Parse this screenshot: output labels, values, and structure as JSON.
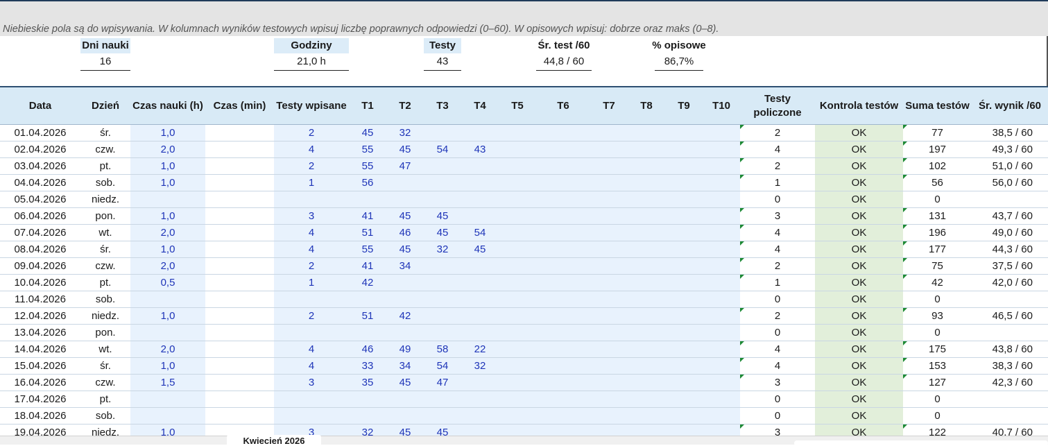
{
  "note": "Niebieskie pola są do wpisywania. W kolumnach wyników testowych wpisuj liczbę poprawnych odpowiedzi (0–60). W opisowych wpisuj: dobrze oraz maks (0–8).",
  "summary": [
    {
      "label": "Dni nauki",
      "value": "16"
    },
    {
      "label": "Godziny",
      "value": "21,0 h"
    },
    {
      "label": "Testy",
      "value": "43"
    },
    {
      "label": "Śr. test /60",
      "value": "44,8  / 60"
    },
    {
      "label": "% opisowe",
      "value": "86,7%"
    }
  ],
  "columns": [
    "Data",
    "Dzień",
    "Czas nauki (h)",
    "Czas (min)",
    "Testy wpisane",
    "T1",
    "T2",
    "T3",
    "T4",
    "T5",
    "T6",
    "T7",
    "T8",
    "T9",
    "T10",
    "Testy policzone",
    "Kontrola testów",
    "Suma testów",
    "Śr. wynik /60"
  ],
  "rows": [
    [
      "01.04.2026",
      "śr.",
      "1,0",
      "",
      "2",
      "45",
      "32",
      "",
      "",
      "",
      "",
      "",
      "",
      "",
      "",
      "2",
      "OK",
      "77",
      "38,5  / 60"
    ],
    [
      "02.04.2026",
      "czw.",
      "2,0",
      "",
      "4",
      "55",
      "45",
      "54",
      "43",
      "",
      "",
      "",
      "",
      "",
      "",
      "4",
      "OK",
      "197",
      "49,3  / 60"
    ],
    [
      "03.04.2026",
      "pt.",
      "1,0",
      "",
      "2",
      "55",
      "47",
      "",
      "",
      "",
      "",
      "",
      "",
      "",
      "",
      "2",
      "OK",
      "102",
      "51,0  / 60"
    ],
    [
      "04.04.2026",
      "sob.",
      "1,0",
      "",
      "1",
      "56",
      "",
      "",
      "",
      "",
      "",
      "",
      "",
      "",
      "",
      "1",
      "OK",
      "56",
      "56,0  / 60"
    ],
    [
      "05.04.2026",
      "niedz.",
      "",
      "",
      "",
      "",
      "",
      "",
      "",
      "",
      "",
      "",
      "",
      "",
      "",
      "0",
      "OK",
      "0",
      ""
    ],
    [
      "06.04.2026",
      "pon.",
      "1,0",
      "",
      "3",
      "41",
      "45",
      "45",
      "",
      "",
      "",
      "",
      "",
      "",
      "",
      "3",
      "OK",
      "131",
      "43,7  / 60"
    ],
    [
      "07.04.2026",
      "wt.",
      "2,0",
      "",
      "4",
      "51",
      "46",
      "45",
      "54",
      "",
      "",
      "",
      "",
      "",
      "",
      "4",
      "OK",
      "196",
      "49,0  / 60"
    ],
    [
      "08.04.2026",
      "śr.",
      "1,0",
      "",
      "4",
      "55",
      "45",
      "32",
      "45",
      "",
      "",
      "",
      "",
      "",
      "",
      "4",
      "OK",
      "177",
      "44,3  / 60"
    ],
    [
      "09.04.2026",
      "czw.",
      "2,0",
      "",
      "2",
      "41",
      "34",
      "",
      "",
      "",
      "",
      "",
      "",
      "",
      "",
      "2",
      "OK",
      "75",
      "37,5  / 60"
    ],
    [
      "10.04.2026",
      "pt.",
      "0,5",
      "",
      "1",
      "42",
      "",
      "",
      "",
      "",
      "",
      "",
      "",
      "",
      "",
      "1",
      "OK",
      "42",
      "42,0  / 60"
    ],
    [
      "11.04.2026",
      "sob.",
      "",
      "",
      "",
      "",
      "",
      "",
      "",
      "",
      "",
      "",
      "",
      "",
      "",
      "0",
      "OK",
      "0",
      ""
    ],
    [
      "12.04.2026",
      "niedz.",
      "1,0",
      "",
      "2",
      "51",
      "42",
      "",
      "",
      "",
      "",
      "",
      "",
      "",
      "",
      "2",
      "OK",
      "93",
      "46,5  / 60"
    ],
    [
      "13.04.2026",
      "pon.",
      "",
      "",
      "",
      "",
      "",
      "",
      "",
      "",
      "",
      "",
      "",
      "",
      "",
      "0",
      "OK",
      "0",
      ""
    ],
    [
      "14.04.2026",
      "wt.",
      "2,0",
      "",
      "4",
      "46",
      "49",
      "58",
      "22",
      "",
      "",
      "",
      "",
      "",
      "",
      "4",
      "OK",
      "175",
      "43,8  / 60"
    ],
    [
      "15.04.2026",
      "śr.",
      "1,0",
      "",
      "4",
      "33",
      "34",
      "54",
      "32",
      "",
      "",
      "",
      "",
      "",
      "",
      "4",
      "OK",
      "153",
      "38,3  / 60"
    ],
    [
      "16.04.2026",
      "czw.",
      "1,5",
      "",
      "3",
      "35",
      "45",
      "47",
      "",
      "",
      "",
      "",
      "",
      "",
      "",
      "3",
      "OK",
      "127",
      "42,3  / 60"
    ],
    [
      "17.04.2026",
      "pt.",
      "",
      "",
      "",
      "",
      "",
      "",
      "",
      "",
      "",
      "",
      "",
      "",
      "",
      "0",
      "OK",
      "0",
      ""
    ],
    [
      "18.04.2026",
      "sob.",
      "",
      "",
      "",
      "",
      "",
      "",
      "",
      "",
      "",
      "",
      "",
      "",
      "",
      "0",
      "OK",
      "0",
      ""
    ],
    [
      "19.04.2026",
      "niedz.",
      "1,0",
      "",
      "3",
      "32",
      "45",
      "45",
      "",
      "",
      "",
      "",
      "",
      "",
      "",
      "3",
      "OK",
      "122",
      "40,7  / 60"
    ]
  ],
  "sheet_tab": "Kwiecień 2026"
}
